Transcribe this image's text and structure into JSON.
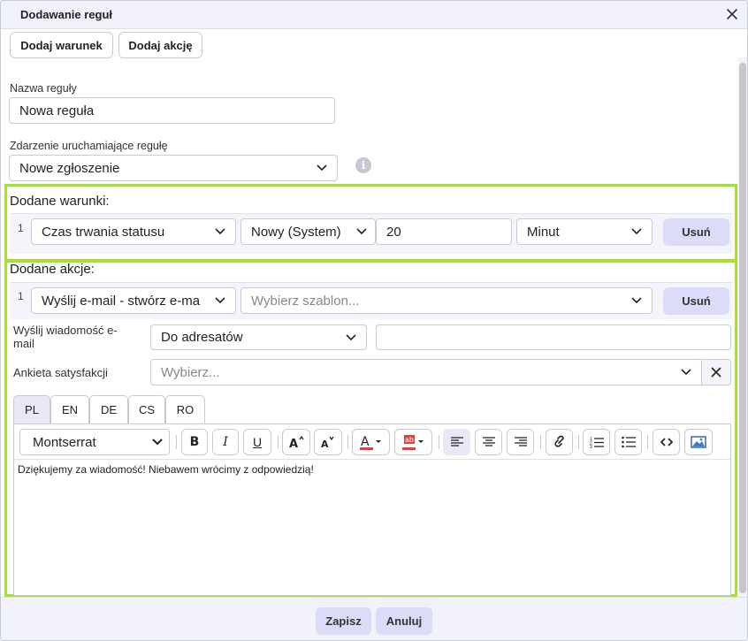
{
  "dialog": {
    "title": "Dodawanie reguł",
    "close_icon": "close-icon"
  },
  "top_buttons": {
    "add_condition": "Dodaj warunek",
    "add_action": "Dodaj akcję"
  },
  "rule_name": {
    "label": "Nazwa reguły",
    "value": "Nowa reguła"
  },
  "trigger": {
    "label": "Zdarzenie uruchamiające regułę",
    "value": "Nowe zgłoszenie",
    "info_icon": "info-icon",
    "info_glyph": "i"
  },
  "conditions": {
    "title": "Dodane warunki:",
    "rows": [
      {
        "number": "1",
        "type": "Czas trwania statusu",
        "status": "Nowy (System)",
        "amount": "20",
        "unit": "Minut",
        "remove_label": "Usuń"
      }
    ]
  },
  "actions": {
    "title": "Dodane akcje:",
    "rows": [
      {
        "number": "1",
        "type": "Wyślij e-mail - stwórz e-ma",
        "template_placeholder": "Wybierz szablon...",
        "remove_label": "Usuń"
      }
    ],
    "send_email": {
      "label": "Wyślij wiadomość e-mail",
      "value": "Do adresatów",
      "extra_value": ""
    },
    "survey": {
      "label": "Ankieta satysfakcji",
      "placeholder": "Wybierz..."
    },
    "language_tabs": [
      "PL",
      "EN",
      "DE",
      "CS",
      "RO"
    ],
    "active_tab": "PL",
    "editor": {
      "font": "Montserrat",
      "content": "Dziękujemy za wiadomość! Niebawem wrócimy z odpowiedzią!",
      "toolbar_icons": [
        "bold-icon",
        "italic-icon",
        "underline-icon",
        "font-size-increase-icon",
        "font-size-decrease-icon",
        "text-color-icon",
        "highlight-color-icon",
        "align-left-icon",
        "align-center-icon",
        "align-right-icon",
        "link-icon",
        "ordered-list-icon",
        "unordered-list-icon",
        "code-icon",
        "image-icon"
      ]
    }
  },
  "footer": {
    "save": "Zapisz",
    "cancel": "Anuluj"
  },
  "colors": {
    "highlight_border": "#a5e22e",
    "accent_button": "#dcdcf8",
    "title_bar": "#f1f2fa"
  }
}
